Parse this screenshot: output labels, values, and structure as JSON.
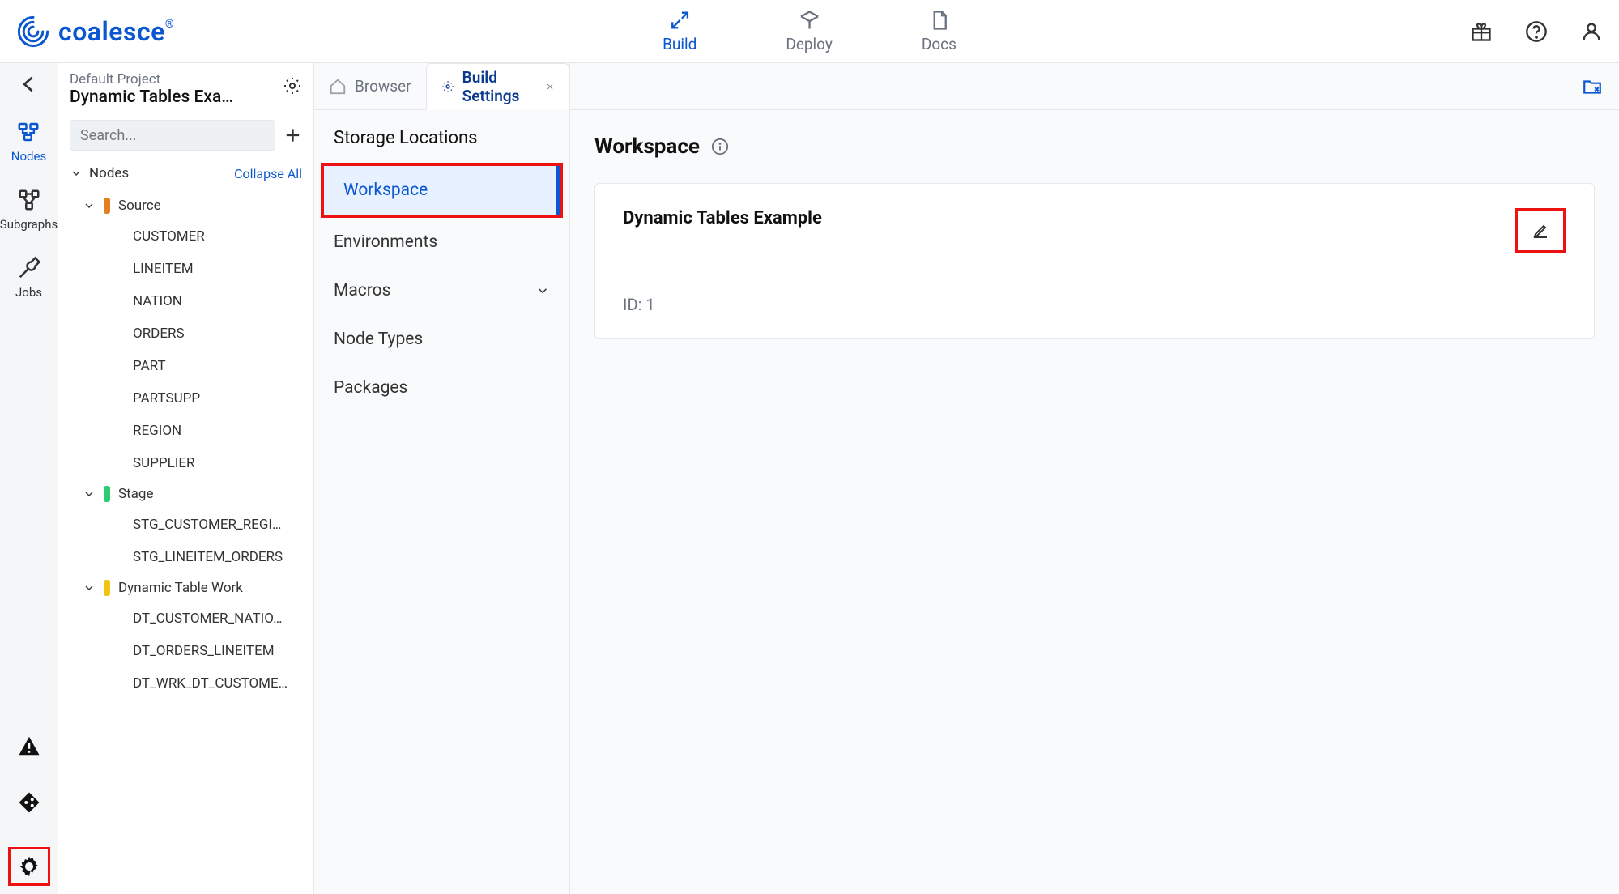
{
  "brand": {
    "name": "coalesce"
  },
  "header_nav": {
    "build": "Build",
    "deploy": "Deploy",
    "docs": "Docs"
  },
  "rail": {
    "nodes": "Nodes",
    "subgraphs": "Subgraphs",
    "jobs": "Jobs"
  },
  "sidebar": {
    "project": "Default Project",
    "workspace_title": "Dynamic Tables Exa…",
    "search_placeholder": "Search...",
    "section_label": "Nodes",
    "collapse_all": "Collapse All",
    "groups": [
      {
        "label": "Source",
        "color": "#e67e22",
        "items": [
          "CUSTOMER",
          "LINEITEM",
          "NATION",
          "ORDERS",
          "PART",
          "PARTSUPP",
          "REGION",
          "SUPPLIER"
        ]
      },
      {
        "label": "Stage",
        "color": "#2ecc71",
        "items": [
          "STG_CUSTOMER_REGI…",
          "STG_LINEITEM_ORDERS"
        ]
      },
      {
        "label": "Dynamic Table Work",
        "color": "#f1c40f",
        "items": [
          "DT_CUSTOMER_NATIO…",
          "DT_ORDERS_LINEITEM",
          "DT_WRK_DT_CUSTOME…"
        ]
      }
    ]
  },
  "tabs": {
    "browser": "Browser",
    "build_settings": "Build Settings"
  },
  "settings_panel": {
    "heading": "Storage Locations",
    "items": {
      "workspace": "Workspace",
      "environments": "Environments",
      "macros": "Macros",
      "node_types": "Node Types",
      "packages": "Packages"
    }
  },
  "content": {
    "title": "Workspace",
    "workspace_name": "Dynamic Tables Example",
    "id_label": "ID: 1"
  }
}
